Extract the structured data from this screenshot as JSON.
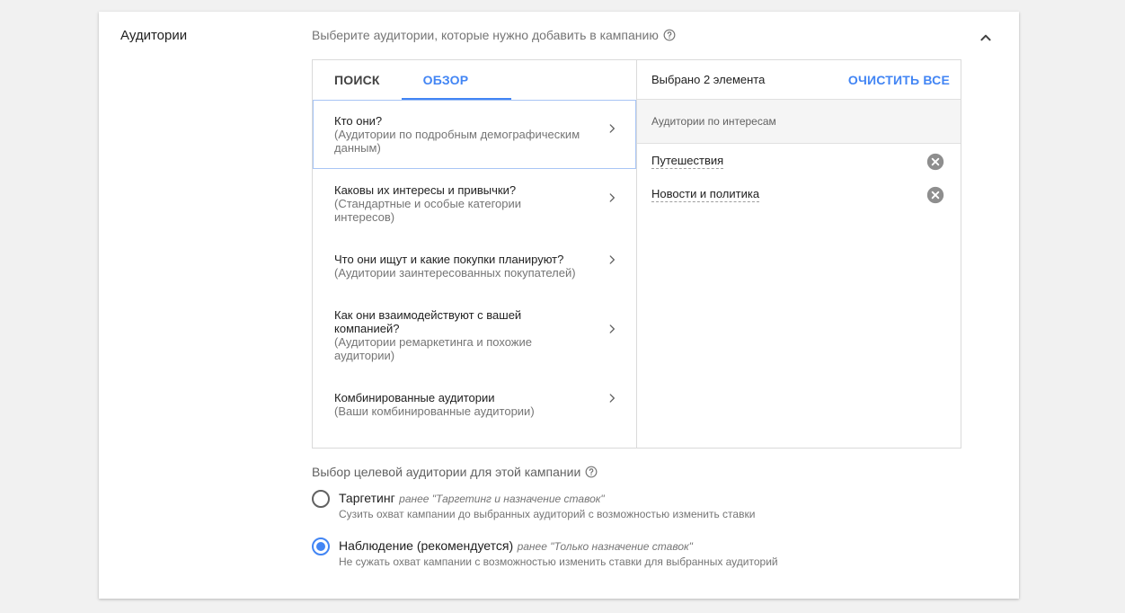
{
  "section": {
    "title": "Аудитории",
    "description": "Выберите аудитории, которые нужно добавить в кампанию"
  },
  "tabs": [
    {
      "label": "ПОИСК"
    },
    {
      "label": "ОБЗОР"
    }
  ],
  "categories": [
    {
      "title": "Кто они?",
      "subtitle": "(Аудитории по подробным демографическим данным)"
    },
    {
      "title": "Каковы их интересы и привычки?",
      "subtitle": "(Стандартные и особые категории интересов)"
    },
    {
      "title": "Что они ищут и какие покупки планируют?",
      "subtitle": "(Аудитории заинтересованных покупателей)"
    },
    {
      "title": "Как они взаимодействуют с вашей компанией?",
      "subtitle": "(Аудитории ремаркетинга и похожие аудитории)"
    },
    {
      "title": "Комбинированные аудитории",
      "subtitle": "(Ваши комбинированные аудитории)"
    }
  ],
  "selected_panel": {
    "count_text": "Выбрано 2 элемента",
    "clear_all": "ОЧИСТИТЬ ВСЕ",
    "group_title": "Аудитории по интересам",
    "items": [
      {
        "label": "Путешествия"
      },
      {
        "label": "Новости и политика"
      }
    ]
  },
  "targeting": {
    "title": "Выбор целевой аудитории для этой кампании",
    "options": [
      {
        "label": "Таргетинг",
        "note": "ранее \"Таргетинг и назначение ставок\"",
        "description": "Сузить охват кампании до выбранных аудиторий с возможностью изменить ставки",
        "checked": false
      },
      {
        "label": "Наблюдение (рекомендуется)",
        "note": "ранее \"Только назначение ставок\"",
        "description": "Не сужать охват кампании с возможностью изменить ставки для выбранных аудиторий",
        "checked": true
      }
    ]
  },
  "colors": {
    "accent": "#4285f4",
    "background": "#f1f1f1",
    "card": "#ffffff"
  }
}
